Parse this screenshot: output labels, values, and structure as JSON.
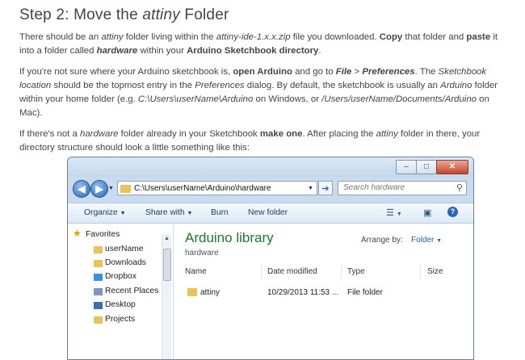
{
  "article": {
    "heading_prefix": "Step 2: Move the ",
    "heading_em": "attiny",
    "heading_suffix": " Folder",
    "p1": {
      "t1": "There should be an ",
      "e1": "attiny",
      "t2": " folder living within the ",
      "e2": "attiny-ide-1.x.x.zip",
      "t3": " file you downloaded. ",
      "b1": "Copy",
      "t4": " that folder and ",
      "b2": "paste",
      "t5": " it into a folder called ",
      "be1": "hardware",
      "t6": " within your ",
      "b3": "Arduino Sketchbook directory",
      "t7": "."
    },
    "p2": {
      "t1": "If you're not sure where your Arduino sketchbook is, ",
      "b1": "open Arduino",
      "t2": " and go to ",
      "be1": "File",
      "t3": " > ",
      "be2": "Preferences",
      "t4": ". The ",
      "e1": "Sketchbook location",
      "t5": " should be the topmost entry in the ",
      "e2": "Preferences",
      "t6": " dialog. By default, the sketchbook is usually an ",
      "e3": "Arduino",
      "t7": " folder within your home folder (e.g. ",
      "e4": "C:\\Users\\userName\\Arduino",
      "t8": " on Windows, or ",
      "e5": "/Users/userName/Documents/Arduino",
      "t9": " on Mac)."
    },
    "p3": {
      "t1": "If there's not a ",
      "e1": "hardware",
      "t2": " folder already in your Sketchbook ",
      "b1": "make one",
      "t3": ". After placing the ",
      "e2": "attiny",
      "t4": " folder in there, your directory structure should look a little something like this:"
    }
  },
  "explorer": {
    "window_buttons": {
      "minimize": "–",
      "maximize": "□",
      "close": "✕"
    },
    "address": "C:\\Users\\userName\\Arduino\\hardware",
    "search_placeholder": "Search hardware",
    "toolbar": {
      "organize": "Organize",
      "share_with": "Share with",
      "burn": "Burn",
      "new_folder": "New folder"
    },
    "nav": {
      "favorites": "Favorites",
      "items": [
        "userName",
        "Downloads",
        "Dropbox",
        "Recent Places",
        "Desktop",
        "Projects"
      ]
    },
    "library_title": "Arduino library",
    "library_subtitle": "hardware",
    "arrange_by_label": "Arrange by:",
    "arrange_by_value": "Folder",
    "columns": [
      "Name",
      "Date modified",
      "Type",
      "Size"
    ],
    "rows": [
      {
        "name": "attiny",
        "date": "10/29/2013 11:53 ...",
        "type": "File folder",
        "size": ""
      }
    ],
    "colors": {
      "library_title": "#1a7a2e",
      "link_blue": "#1e5fb4"
    }
  }
}
